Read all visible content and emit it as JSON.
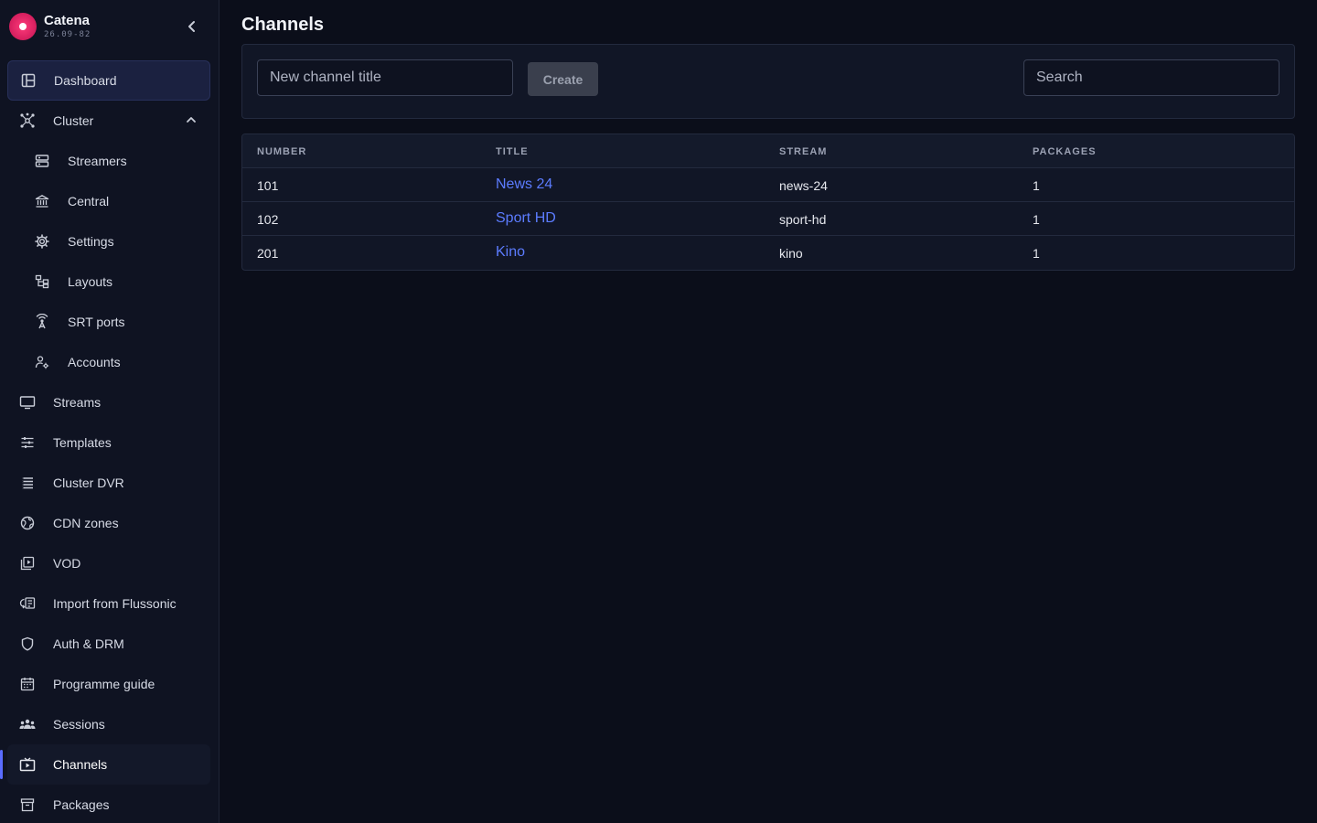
{
  "app": {
    "name": "Catena",
    "version": "26.09-82"
  },
  "sidebar": {
    "items": [
      {
        "label": "Dashboard",
        "icon": "dashboard-icon"
      },
      {
        "label": "Cluster",
        "icon": "cluster-icon"
      },
      {
        "label": "Streamers",
        "icon": "server-icon"
      },
      {
        "label": "Central",
        "icon": "bank-icon"
      },
      {
        "label": "Settings",
        "icon": "gear-icon"
      },
      {
        "label": "Layouts",
        "icon": "layouts-icon"
      },
      {
        "label": "SRT ports",
        "icon": "antenna-icon"
      },
      {
        "label": "Accounts",
        "icon": "user-gear-icon"
      },
      {
        "label": "Streams",
        "icon": "monitor-icon"
      },
      {
        "label": "Templates",
        "icon": "sliders-icon"
      },
      {
        "label": "Cluster DVR",
        "icon": "list-icon"
      },
      {
        "label": "CDN zones",
        "icon": "globe-icon"
      },
      {
        "label": "VOD",
        "icon": "video-library-icon"
      },
      {
        "label": "Import from Flussonic",
        "icon": "import-icon"
      },
      {
        "label": "Auth & DRM",
        "icon": "shield-icon"
      },
      {
        "label": "Programme guide",
        "icon": "calendar-icon"
      },
      {
        "label": "Sessions",
        "icon": "users-icon"
      },
      {
        "label": "Channels",
        "icon": "tv-icon"
      },
      {
        "label": "Packages",
        "icon": "archive-icon"
      }
    ]
  },
  "page": {
    "title": "Channels",
    "new_placeholder": "New channel title",
    "create_label": "Create",
    "search_placeholder": "Search"
  },
  "table": {
    "headers": [
      "NUMBER",
      "TITLE",
      "STREAM",
      "PACKAGES"
    ],
    "rows": [
      {
        "number": "101",
        "title": "News 24",
        "stream": "news-24",
        "packages": "1"
      },
      {
        "number": "102",
        "title": "Sport HD",
        "stream": "sport-hd",
        "packages": "1"
      },
      {
        "number": "201",
        "title": "Kino",
        "stream": "kino",
        "packages": "1"
      }
    ]
  },
  "colors": {
    "accent": "#5c7cff",
    "brand": "#e0245e",
    "background": "#0b0e1a"
  }
}
